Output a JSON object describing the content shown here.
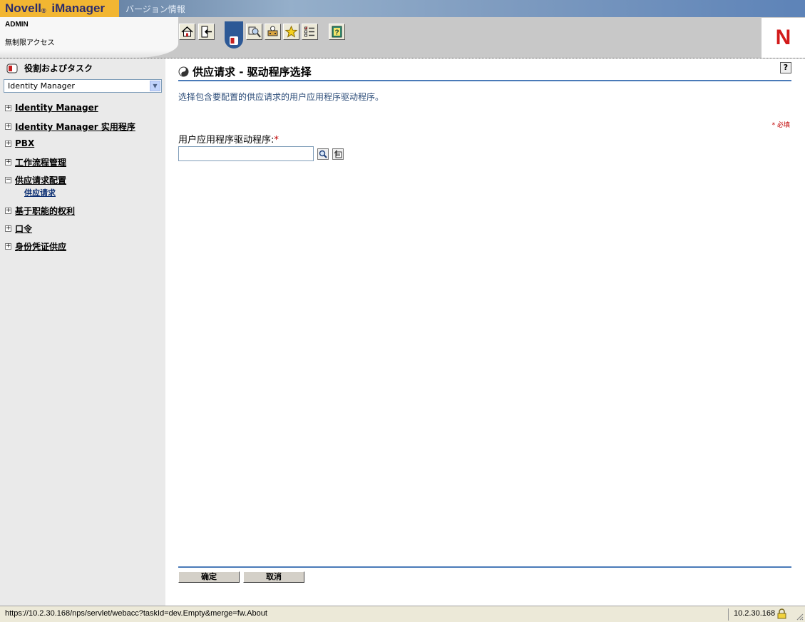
{
  "app": {
    "brand_main": "Novell",
    "brand_reg": "®",
    "brand_product": " iManager",
    "banner_link": "バージョン情報"
  },
  "user": {
    "name": "ADMIN",
    "access": "無制限アクセス"
  },
  "toolbar": {
    "items": [
      "home-icon",
      "exit-icon",
      "roles-tasks-icon",
      "view-objects-icon",
      "configure-icon",
      "favorites-icon",
      "preferences-icon",
      "help-book-icon"
    ]
  },
  "sidebar": {
    "title": "役割およびタスク",
    "selected_role": "Identity Manager",
    "items": [
      {
        "label": "Identity Manager",
        "expander": "+"
      },
      {
        "label": "Identity Manager 实用程序",
        "expander": "+"
      },
      {
        "label": "PBX",
        "expander": "+"
      },
      {
        "label": "工作流程管理",
        "expander": "+"
      },
      {
        "label": "供应请求配置",
        "expander": "−",
        "sub": "供应请求"
      },
      {
        "label": "基于职能的权利",
        "expander": "+"
      },
      {
        "label": "口令",
        "expander": "+"
      },
      {
        "label": "身份凭证供应",
        "expander": "+"
      }
    ]
  },
  "main": {
    "title": "供应请求 - 驱动程序选择",
    "help": "?",
    "description": "选择包含要配置的供应请求的用户应用程序驱动程序。",
    "required_note": "* 必填",
    "field_label": "用户应用程序驱动程序:",
    "field_required_marker": "*",
    "field_value": "",
    "ok_label": "确定",
    "cancel_label": "取消"
  },
  "status": {
    "url": "https://10.2.30.168/nps/servlet/webacc?taskId=dev.Empty&merge=fw.About",
    "host": "10.2.30.168"
  }
}
